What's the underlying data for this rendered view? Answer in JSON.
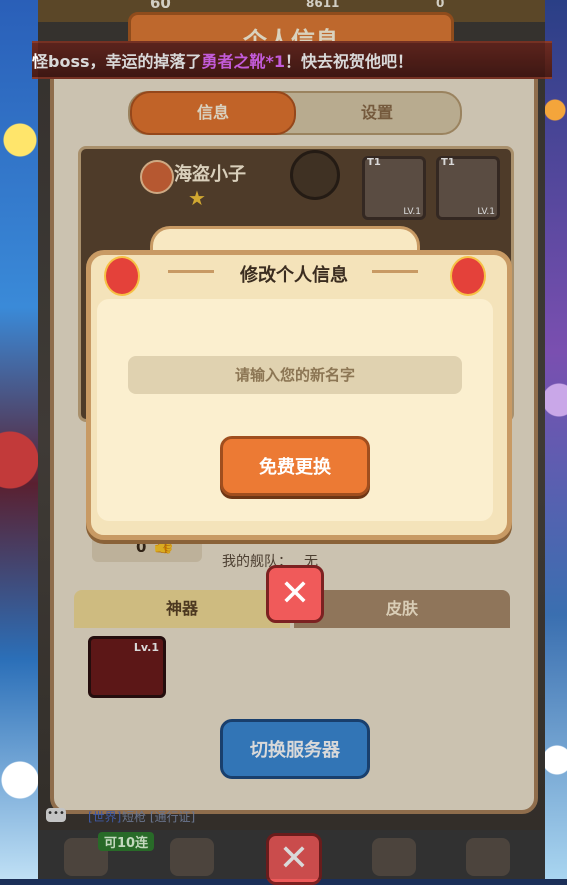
{
  "hud": {
    "stamina_value": "60",
    "coins_value": "8611",
    "gems_value": "0"
  },
  "panel": {
    "title": "个人信息"
  },
  "announcement": {
    "prefix": "怪boss，幸运的掉落了",
    "item": "勇者之靴*1",
    "suffix": "！快去祝贺他吧！"
  },
  "tabs": [
    "信息",
    "设置"
  ],
  "profile": {
    "player_name": "海盗小子",
    "slots": [
      {
        "tier": "T1",
        "level": "LV.1"
      },
      {
        "tier": "T1",
        "level": "LV.1"
      }
    ]
  },
  "likes": {
    "count": "0"
  },
  "fleet": {
    "label": "我的舰队：",
    "value": "无"
  },
  "lower_tabs": [
    "神器",
    "皮肤"
  ],
  "artifact": {
    "level": "Lv.1"
  },
  "switch_server": {
    "label": "切换服务器"
  },
  "chat": {
    "icon_text": "•••",
    "channel": "[世界]",
    "text": "短枪 [通行证]"
  },
  "bottom": {
    "badge": "可10连"
  },
  "modal": {
    "title": "修改个人信息",
    "input_placeholder": "请输入您的新名字",
    "confirm_label": "免费更换"
  },
  "colors": {
    "accent_orange": "#ec7a34",
    "close_red": "#f05a5a",
    "switch_blue": "#3b8ad6",
    "announce_purple": "#e56bff"
  }
}
